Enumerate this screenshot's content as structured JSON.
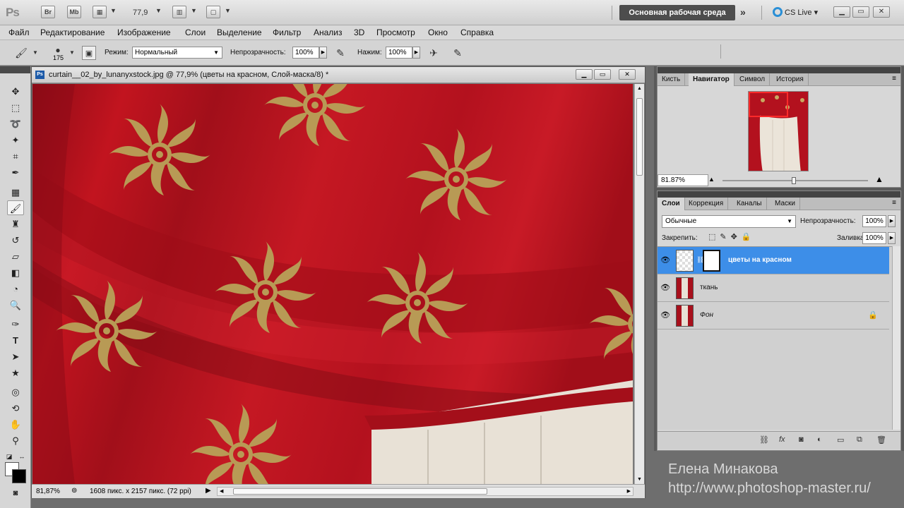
{
  "appbar": {
    "logo": "Ps",
    "bridge": "Br",
    "minibridge": "Mb",
    "zoom": "77,9",
    "workspace": "Основная рабочая среда",
    "cslive": "CS Live"
  },
  "menu": [
    "Файл",
    "Редактирование",
    "Изображение",
    "Слои",
    "Выделение",
    "Фильтр",
    "Анализ",
    "3D",
    "Просмотр",
    "Окно",
    "Справка"
  ],
  "options": {
    "brush_size": "175",
    "mode_label": "Режим:",
    "mode_value": "Нормальный",
    "opacity_label": "Непрозрачность:",
    "opacity_value": "100%",
    "flow_label": "Нажим:",
    "flow_value": "100%"
  },
  "document": {
    "title": "curtain__02_by_lunanyxstock.jpg @ 77,9% (цветы на красном, Слой-маска/8) *",
    "status_zoom": "81,87%",
    "status_info": "1608 пикс. x 2157 пикс. (72 ppi)"
  },
  "navigator": {
    "tabs": [
      "Кисть",
      "Навигатор",
      "Символ",
      "История"
    ],
    "active_tab": "Навигатор",
    "zoom": "81.87%"
  },
  "layers": {
    "tabs": [
      "Слои",
      "Коррекция",
      "Каналы",
      "Маски"
    ],
    "blend_mode": "Обычные",
    "opacity_label": "Непрозрачность:",
    "opacity_value": "100%",
    "lock_label": "Закрепить:",
    "fill_label": "Заливка:",
    "fill_value": "100%",
    "items": [
      {
        "name": "цветы на красном",
        "selected": true
      },
      {
        "name": "ткань",
        "selected": false
      },
      {
        "name": "Фон",
        "selected": false,
        "locked": true
      }
    ]
  },
  "watermark": {
    "name": "Елена Минакова",
    "url": "http://www.photoshop-master.ru/"
  },
  "colors": {
    "curtain": "#b3111f",
    "flower": "#b89a55",
    "selection": "#3d8ee8",
    "workspace_button": "#4d4d4d"
  }
}
